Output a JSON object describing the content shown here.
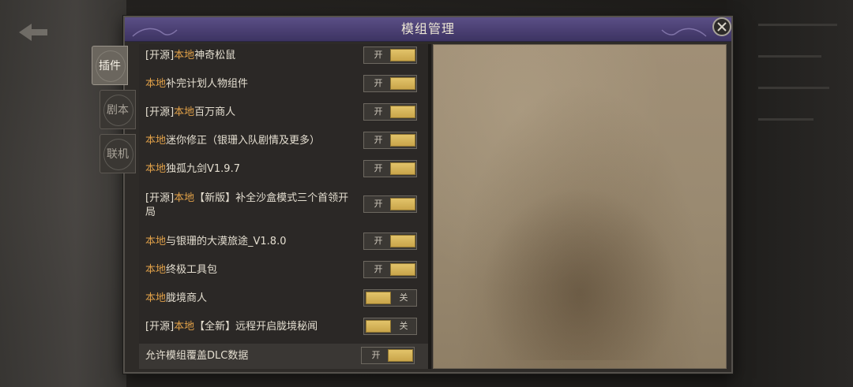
{
  "dialog": {
    "title": "模组管理"
  },
  "tabs": [
    {
      "label": "插件",
      "active": true
    },
    {
      "label": "剧本",
      "active": false
    },
    {
      "label": "联机",
      "active": false
    }
  ],
  "mods": [
    {
      "prefix": "[开源]",
      "local": "本地",
      "rest": "神奇松鼠",
      "state": "on",
      "toggle_label": "开"
    },
    {
      "prefix": "",
      "local": "本地",
      "rest": "补完计划人物组件",
      "state": "on",
      "toggle_label": "开"
    },
    {
      "prefix": "[开源]",
      "local": "本地",
      "rest": "百万商人",
      "state": "on",
      "toggle_label": "开"
    },
    {
      "prefix": "",
      "local": "本地",
      "rest": "迷你修正（银珊入队剧情及更多）",
      "state": "on",
      "toggle_label": "开"
    },
    {
      "prefix": "",
      "local": "本地",
      "rest": "独孤九剑V1.9.7",
      "state": "on",
      "toggle_label": "开"
    },
    {
      "prefix": "[开源]",
      "local": "本地",
      "rest": "【新版】补全沙盒模式三个首领开局",
      "state": "on",
      "toggle_label": "开"
    },
    {
      "prefix": "",
      "local": "本地",
      "rest": "与银珊的大漠旅途_V1.8.0",
      "state": "on",
      "toggle_label": "开"
    },
    {
      "prefix": "",
      "local": "本地",
      "rest": "终极工具包",
      "state": "on",
      "toggle_label": "开"
    },
    {
      "prefix": "",
      "local": "本地",
      "rest": "胧境商人",
      "state": "off",
      "toggle_label": "关"
    },
    {
      "prefix": "[开源]",
      "local": "本地",
      "rest": "【全新】远程开启胧境秘闻",
      "state": "off",
      "toggle_label": "关"
    }
  ],
  "dlc_override": {
    "label": "允许模组覆盖DLC数据",
    "state": "on",
    "toggle_label": "开"
  },
  "colors": {
    "title_bar": "#4a3f72",
    "local_tag": "#e0a048",
    "toggle_knob": "#d4b358",
    "detail_bg": "#9a8a71"
  }
}
